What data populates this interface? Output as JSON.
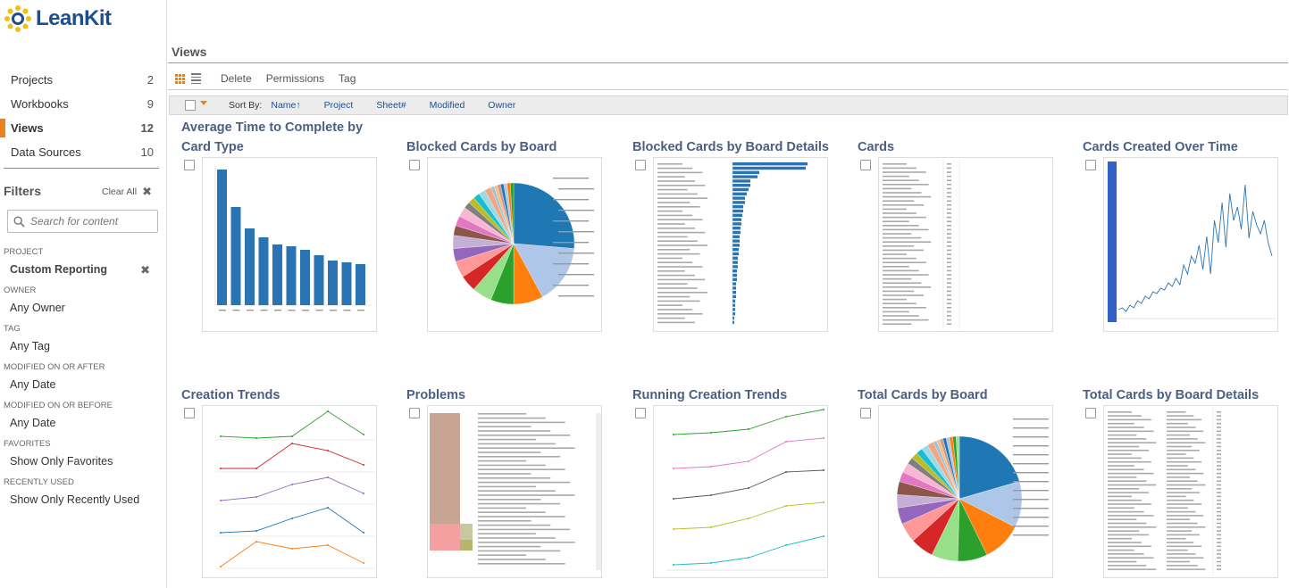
{
  "app": {
    "logo_text": "LeanKit"
  },
  "sidebar": {
    "nav": [
      {
        "label": "Projects",
        "count": "2"
      },
      {
        "label": "Workbooks",
        "count": "9"
      },
      {
        "label": "Views",
        "count": "12"
      },
      {
        "label": "Data Sources",
        "count": "10"
      }
    ],
    "active_nav": "Views",
    "filters_title": "Filters",
    "clear_all": "Clear All",
    "search_placeholder": "Search for content",
    "filters": [
      {
        "label": "PROJECT",
        "value": "Custom Reporting"
      },
      {
        "label": "OWNER",
        "value": "Any Owner"
      },
      {
        "label": "TAG",
        "value": "Any Tag"
      },
      {
        "label": "MODIFIED ON OR AFTER",
        "value": "Any Date"
      },
      {
        "label": "MODIFIED ON OR BEFORE",
        "value": "Any Date"
      },
      {
        "label": "FAVORITES",
        "value": "Show Only Favorites"
      },
      {
        "label": "RECENTLY USED",
        "value": "Show Only Recently Used"
      }
    ]
  },
  "main": {
    "title": "Views",
    "toolbar": {
      "delete": "Delete",
      "permissions": "Permissions",
      "tag": "Tag"
    },
    "sort": {
      "label": "Sort By:",
      "options": [
        "Name↑",
        "Project",
        "Sheet#",
        "Modified",
        "Owner"
      ]
    },
    "views": [
      {
        "title": "Average Time to Complete by Card Type",
        "thumb": "bar"
      },
      {
        "title": "Blocked Cards by Board",
        "thumb": "pie"
      },
      {
        "title": "Blocked Cards by Board Details",
        "thumb": "hbar"
      },
      {
        "title": "Cards",
        "thumb": "table"
      },
      {
        "title": "Cards Created Over Time",
        "thumb": "line"
      },
      {
        "title": "Creation Trends",
        "thumb": "multiline"
      },
      {
        "title": "Problems",
        "thumb": "treemap"
      },
      {
        "title": "Running Creation Trends",
        "thumb": "running"
      },
      {
        "title": "Total Cards by Board",
        "thumb": "pie2"
      },
      {
        "title": "Total Cards by Board Details",
        "thumb": "table2"
      }
    ]
  },
  "colors": {
    "accent": "#e8821e",
    "title": "#4a5f82",
    "link": "#1f4e8c",
    "bar": "#2a74b4"
  }
}
